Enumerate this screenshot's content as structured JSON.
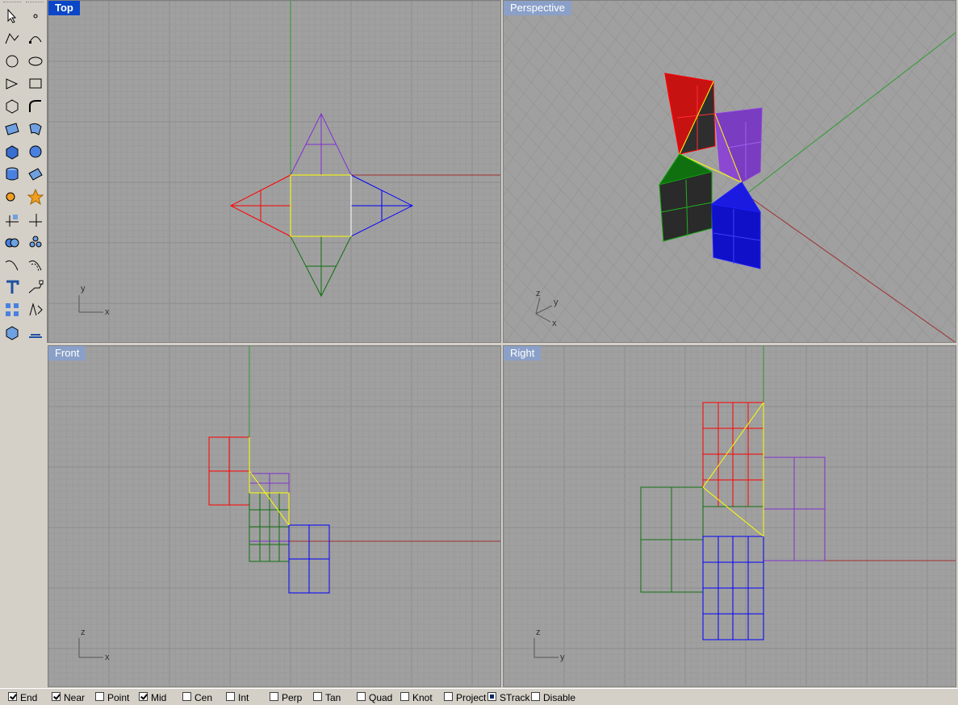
{
  "viewports": {
    "top": {
      "label": "Top",
      "axis1": "y",
      "axis2": "x"
    },
    "perspective": {
      "label": "Perspective",
      "axis1": "z",
      "axis2": "y",
      "axis3": "x"
    },
    "front": {
      "label": "Front",
      "axis1": "z",
      "axis2": "x"
    },
    "right": {
      "label": "Right",
      "axis1": "z",
      "axis2": "y"
    }
  },
  "colors": {
    "viewport_bg": "#a0a0a0",
    "grid_minor": "#9a9a9a",
    "grid_major": "#8c8c8c",
    "x_axis": "#a03030",
    "y_axis": "#2f9a2f",
    "red": "#ff0000",
    "purple": "#8030d0",
    "green": "#107010",
    "blue": "#0000ff",
    "yellow": "#ffff00",
    "active_label": "#0a46c8"
  },
  "toolbar": {
    "tools": [
      "select-icon",
      "point-icon",
      "polyline-icon",
      "curve-icon",
      "circle-icon",
      "ellipse-icon",
      "arc-icon",
      "rectangle-icon",
      "polygon-icon",
      "fillet-icon",
      "surface-icon",
      "loft-icon",
      "box-icon",
      "sphere-icon",
      "cylinder-icon",
      "mesh-icon",
      "transform-icon",
      "explode-icon",
      "trim-icon",
      "split-icon",
      "boolean-icon",
      "group-icon",
      "curve-tools-icon",
      "offset-icon",
      "text-icon",
      "dimension-icon",
      "array-icon",
      "analyze-icon",
      "render-icon",
      "more-icon"
    ]
  },
  "statusbar": {
    "snaps": [
      {
        "label": "End",
        "state": "checked"
      },
      {
        "label": "Near",
        "state": "checked"
      },
      {
        "label": "Point",
        "state": "unchecked"
      },
      {
        "label": "Mid",
        "state": "checked"
      },
      {
        "label": "Cen",
        "state": "unchecked"
      },
      {
        "label": "Int",
        "state": "unchecked"
      },
      {
        "label": "Perp",
        "state": "unchecked"
      },
      {
        "label": "Tan",
        "state": "unchecked"
      },
      {
        "label": "Quad",
        "state": "unchecked"
      },
      {
        "label": "Knot",
        "state": "unchecked"
      },
      {
        "label": "Project",
        "state": "unchecked"
      },
      {
        "label": "STrack",
        "state": "filled"
      },
      {
        "label": "Disable",
        "state": "unchecked"
      }
    ]
  }
}
